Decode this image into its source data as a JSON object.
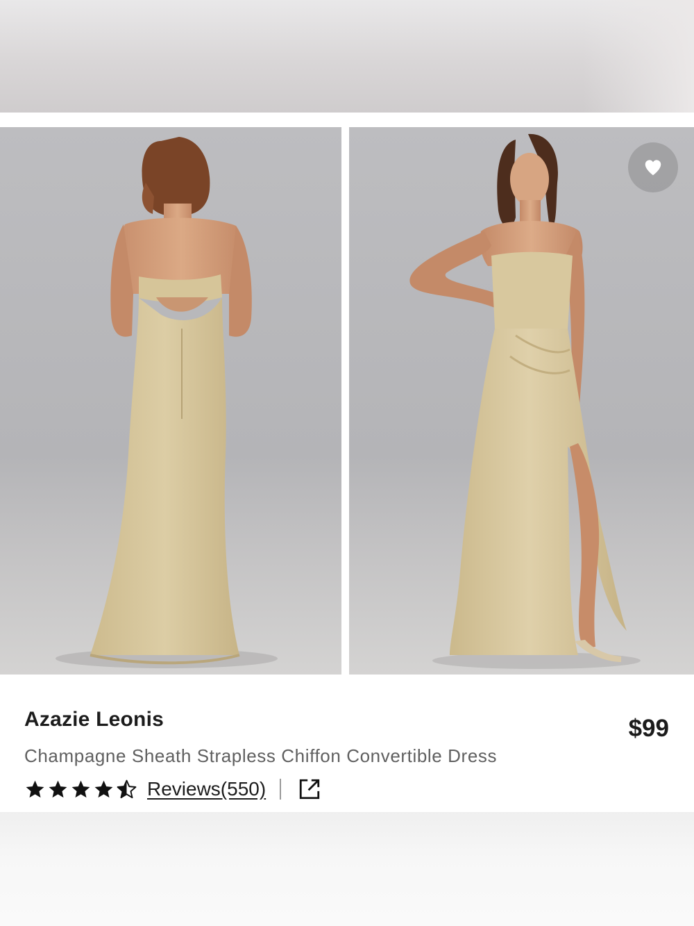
{
  "product": {
    "brand": "Azazie Leonis",
    "name": "Champagne Sheath Strapless Chiffon Convertible Dress",
    "price": "$99",
    "rating": 4.5,
    "reviews_label": "Reviews(550)",
    "divider": "|"
  },
  "gallery": {
    "images": [
      {
        "view": "back",
        "alt": "Model wearing champagne strapless gown, back view"
      },
      {
        "view": "front",
        "alt": "Model wearing champagne strapless gown with thigh slit, front view"
      }
    ]
  },
  "icons": {
    "favorite": "heart-icon",
    "share": "external-link-icon",
    "star": "star-icon"
  },
  "colors": {
    "dress": "#d9c9a0",
    "text_primary": "#1c1c1c",
    "text_secondary": "#5f5f5f",
    "photo_backdrop": "#b8b8bb"
  }
}
